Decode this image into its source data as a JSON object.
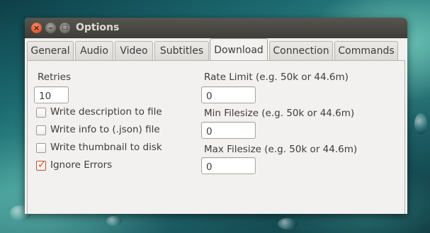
{
  "window": {
    "title": "Options"
  },
  "tabs": [
    {
      "label": "General"
    },
    {
      "label": "Audio"
    },
    {
      "label": "Video"
    },
    {
      "label": "Subtitles"
    },
    {
      "label": "Download"
    },
    {
      "label": "Connection"
    },
    {
      "label": "Commands"
    }
  ],
  "active_tab": "Download",
  "download": {
    "retries_label": "Retries",
    "retries_value": "10",
    "checkboxes": [
      {
        "label": "Write description to file",
        "checked": false
      },
      {
        "label": "Write info to (.json) file",
        "checked": false
      },
      {
        "label": "Write thumbnail to disk",
        "checked": false
      },
      {
        "label": "Ignore Errors",
        "checked": true
      }
    ],
    "rate_limit_label": "Rate Limit (e.g. 50k or 44.6m)",
    "rate_limit_value": "0",
    "min_filesize_label": "Min Filesize (e.g. 50k or 44.6m)",
    "min_filesize_value": "0",
    "max_filesize_label": "Max Filesize (e.g. 50k or 44.6m)",
    "max_filesize_value": "0"
  },
  "colors": {
    "accent": "#e0572d",
    "titlebar": "#3e3d39",
    "window_bg": "#f2f1f0"
  }
}
